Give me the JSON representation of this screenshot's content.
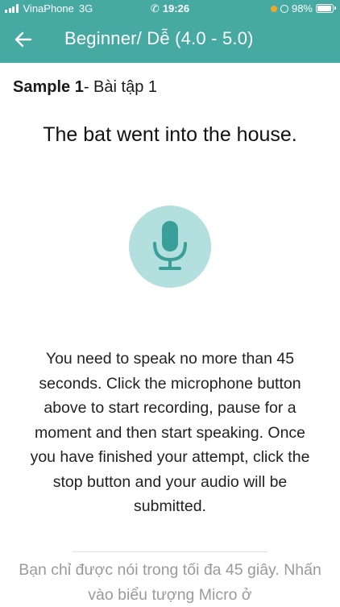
{
  "status_bar": {
    "carrier": "VinaPhone",
    "network": "3G",
    "time": "19:26",
    "battery": "98%",
    "battery_level": 0.98
  },
  "header": {
    "title": "Beginner/ Dễ (4.0 - 5.0)"
  },
  "sample": {
    "label": "Sample 1",
    "subtitle": "- Bài tập 1"
  },
  "sentence": "The bat went into the house.",
  "instructions_en": "You need to speak no more than 45 seconds. Click the microphone button above to start recording, pause for a moment and then start speaking. Once you have finished your attempt, click the stop button and your audio will be submitted.",
  "instructions_vi": "Bạn chỉ được nói trong tối đa 45 giây. Nhấn vào biểu tượng Micro ở",
  "colors": {
    "accent": "#46a9a2",
    "mic_bg": "#b3e0de",
    "mic_icon": "#3a9e99"
  },
  "icons": {
    "back": "arrow-left-icon",
    "mic": "microphone-icon"
  }
}
